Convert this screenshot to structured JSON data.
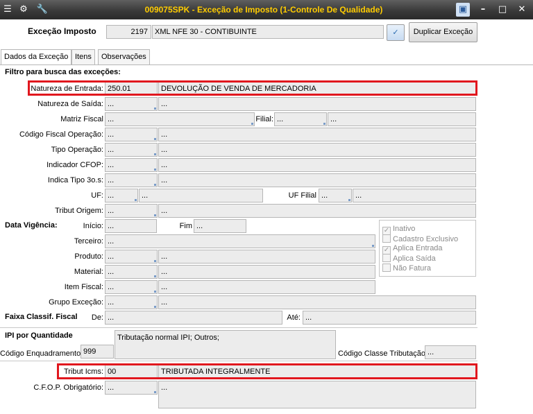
{
  "window": {
    "title": "009075SPK - Exceção de Imposto (1-Controle De Qualidade)"
  },
  "header": {
    "label": "Exceção Imposto",
    "code": "2197",
    "description": "XML NFE 30 - CONTIBUINTE",
    "confirm_icon": "check-icon",
    "duplicate_label": "Duplicar Exceção"
  },
  "tabs": [
    "Dados da Exceção",
    "Itens",
    "Observações"
  ],
  "filter": {
    "section_title": "Filtro para busca das exceções:",
    "natureza_entrada": {
      "label": "Natureza de Entrada:",
      "code": "250.01",
      "desc": "DEVOLUÇÃO DE VENDA DE MERCADORIA"
    },
    "natureza_saida": {
      "label": "Natureza de Saída:",
      "code": "...",
      "desc": "..."
    },
    "matriz_fiscal": {
      "label": "Matriz Fiscal",
      "code": "..."
    },
    "filial": {
      "label": "Filial:",
      "code": "...",
      "desc": "..."
    },
    "codigo_fiscal": {
      "label": "Código Fiscal Operação:",
      "code": "...",
      "desc": "..."
    },
    "tipo_operacao": {
      "label": "Tipo Operação:",
      "code": "...",
      "desc": "..."
    },
    "indicador_cfop": {
      "label": "Indicador CFOP:",
      "code": "...",
      "desc": "..."
    },
    "indica_tipo": {
      "label": "Indica Tipo 3o.s:",
      "code": "...",
      "desc": "..."
    },
    "uf": {
      "label": "UF:",
      "code": "...",
      "desc": "..."
    },
    "uf_filial": {
      "label": "UF Filial",
      "code": "...",
      "desc": "..."
    },
    "tribut_origem": {
      "label": "Tribut Origem:",
      "code": "...",
      "desc": "..."
    }
  },
  "vigencia": {
    "title": "Data Vigência:",
    "inicio_label": "Início:",
    "inicio": "...",
    "fim_label": "Fim",
    "fim": "..."
  },
  "checkboxes": [
    {
      "label": "Inativo",
      "checked": true
    },
    {
      "label": "Cadastro Exclusivo",
      "checked": false
    },
    {
      "label": "Aplica Entrada",
      "checked": true
    },
    {
      "label": "Aplica Saída",
      "checked": false
    },
    {
      "label": "Não Fatura",
      "checked": false
    }
  ],
  "terceiro": {
    "label": "Terceiro:",
    "value": "..."
  },
  "produto": {
    "label": "Produto:",
    "code": "...",
    "desc": "..."
  },
  "material": {
    "label": "Material:",
    "code": "...",
    "desc": "..."
  },
  "item_fiscal": {
    "label": "Item Fiscal:",
    "code": "...",
    "desc": "..."
  },
  "grupo_excecao": {
    "label": "Grupo Exceção:",
    "code": "...",
    "desc": "..."
  },
  "faixa": {
    "title": "Faixa Classif. Fiscal",
    "de_label": "De:",
    "de": "...",
    "ate_label": "Até:",
    "ate": "..."
  },
  "ipi": {
    "title": "IPI por Quantidade",
    "enq_label": "Código Enquadramento",
    "enq_value": "999",
    "enq_desc": "Tributação normal IPI; Outros;",
    "classe_label": "Código Classe Tributação",
    "classe_value": "..."
  },
  "icms": {
    "label": "Tribut Icms:",
    "code": "00",
    "desc": "TRIBUTADA INTEGRALMENTE"
  },
  "cfop_obrig": {
    "label": "C.F.O.P. Obrigatório:",
    "code": "...",
    "desc": "..."
  }
}
